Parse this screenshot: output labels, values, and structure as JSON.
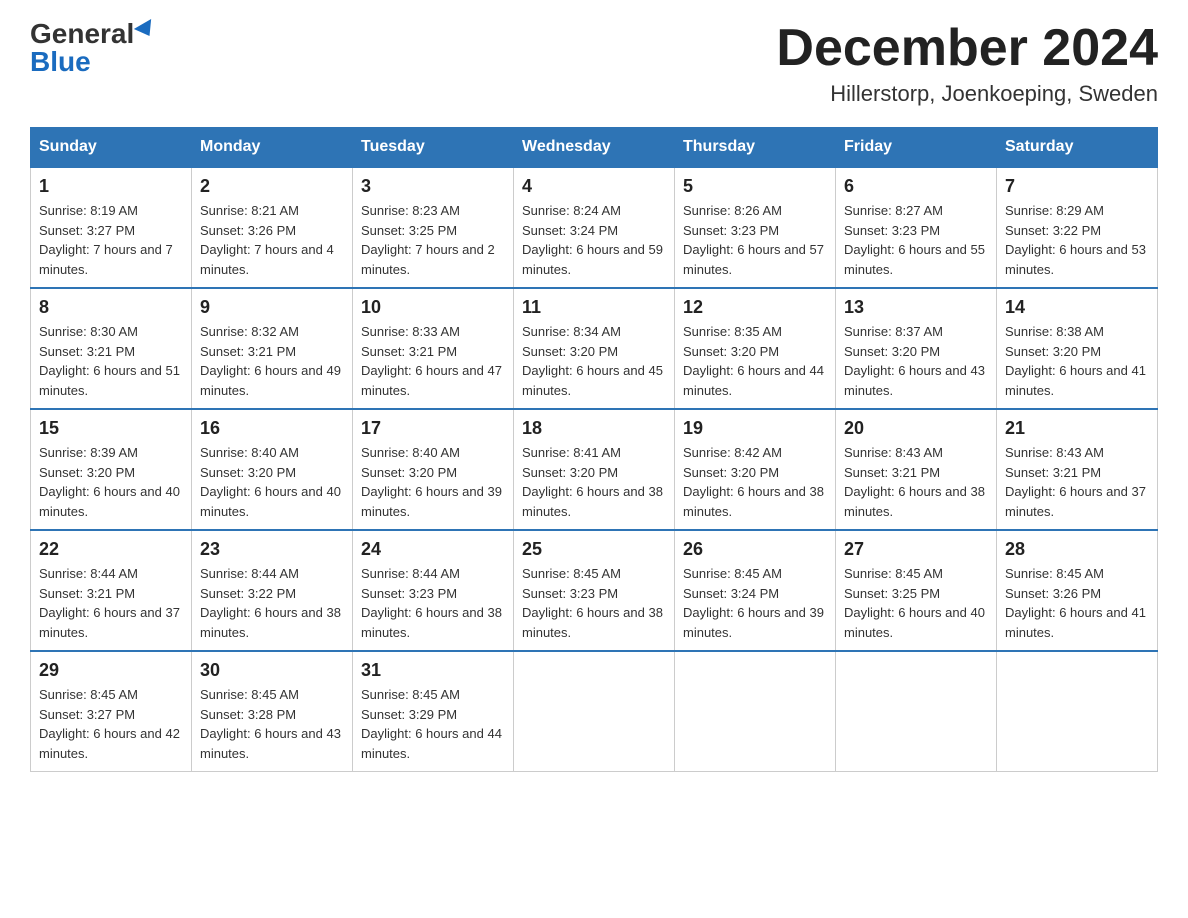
{
  "header": {
    "logo_general": "General",
    "logo_blue": "Blue",
    "month_title": "December 2024",
    "location": "Hillerstorp, Joenkoeping, Sweden"
  },
  "days_of_week": [
    "Sunday",
    "Monday",
    "Tuesday",
    "Wednesday",
    "Thursday",
    "Friday",
    "Saturday"
  ],
  "weeks": [
    [
      {
        "day": "1",
        "sunrise": "8:19 AM",
        "sunset": "3:27 PM",
        "daylight": "7 hours and 7 minutes."
      },
      {
        "day": "2",
        "sunrise": "8:21 AM",
        "sunset": "3:26 PM",
        "daylight": "7 hours and 4 minutes."
      },
      {
        "day": "3",
        "sunrise": "8:23 AM",
        "sunset": "3:25 PM",
        "daylight": "7 hours and 2 minutes."
      },
      {
        "day": "4",
        "sunrise": "8:24 AM",
        "sunset": "3:24 PM",
        "daylight": "6 hours and 59 minutes."
      },
      {
        "day": "5",
        "sunrise": "8:26 AM",
        "sunset": "3:23 PM",
        "daylight": "6 hours and 57 minutes."
      },
      {
        "day": "6",
        "sunrise": "8:27 AM",
        "sunset": "3:23 PM",
        "daylight": "6 hours and 55 minutes."
      },
      {
        "day": "7",
        "sunrise": "8:29 AM",
        "sunset": "3:22 PM",
        "daylight": "6 hours and 53 minutes."
      }
    ],
    [
      {
        "day": "8",
        "sunrise": "8:30 AM",
        "sunset": "3:21 PM",
        "daylight": "6 hours and 51 minutes."
      },
      {
        "day": "9",
        "sunrise": "8:32 AM",
        "sunset": "3:21 PM",
        "daylight": "6 hours and 49 minutes."
      },
      {
        "day": "10",
        "sunrise": "8:33 AM",
        "sunset": "3:21 PM",
        "daylight": "6 hours and 47 minutes."
      },
      {
        "day": "11",
        "sunrise": "8:34 AM",
        "sunset": "3:20 PM",
        "daylight": "6 hours and 45 minutes."
      },
      {
        "day": "12",
        "sunrise": "8:35 AM",
        "sunset": "3:20 PM",
        "daylight": "6 hours and 44 minutes."
      },
      {
        "day": "13",
        "sunrise": "8:37 AM",
        "sunset": "3:20 PM",
        "daylight": "6 hours and 43 minutes."
      },
      {
        "day": "14",
        "sunrise": "8:38 AM",
        "sunset": "3:20 PM",
        "daylight": "6 hours and 41 minutes."
      }
    ],
    [
      {
        "day": "15",
        "sunrise": "8:39 AM",
        "sunset": "3:20 PM",
        "daylight": "6 hours and 40 minutes."
      },
      {
        "day": "16",
        "sunrise": "8:40 AM",
        "sunset": "3:20 PM",
        "daylight": "6 hours and 40 minutes."
      },
      {
        "day": "17",
        "sunrise": "8:40 AM",
        "sunset": "3:20 PM",
        "daylight": "6 hours and 39 minutes."
      },
      {
        "day": "18",
        "sunrise": "8:41 AM",
        "sunset": "3:20 PM",
        "daylight": "6 hours and 38 minutes."
      },
      {
        "day": "19",
        "sunrise": "8:42 AM",
        "sunset": "3:20 PM",
        "daylight": "6 hours and 38 minutes."
      },
      {
        "day": "20",
        "sunrise": "8:43 AM",
        "sunset": "3:21 PM",
        "daylight": "6 hours and 38 minutes."
      },
      {
        "day": "21",
        "sunrise": "8:43 AM",
        "sunset": "3:21 PM",
        "daylight": "6 hours and 37 minutes."
      }
    ],
    [
      {
        "day": "22",
        "sunrise": "8:44 AM",
        "sunset": "3:21 PM",
        "daylight": "6 hours and 37 minutes."
      },
      {
        "day": "23",
        "sunrise": "8:44 AM",
        "sunset": "3:22 PM",
        "daylight": "6 hours and 38 minutes."
      },
      {
        "day": "24",
        "sunrise": "8:44 AM",
        "sunset": "3:23 PM",
        "daylight": "6 hours and 38 minutes."
      },
      {
        "day": "25",
        "sunrise": "8:45 AM",
        "sunset": "3:23 PM",
        "daylight": "6 hours and 38 minutes."
      },
      {
        "day": "26",
        "sunrise": "8:45 AM",
        "sunset": "3:24 PM",
        "daylight": "6 hours and 39 minutes."
      },
      {
        "day": "27",
        "sunrise": "8:45 AM",
        "sunset": "3:25 PM",
        "daylight": "6 hours and 40 minutes."
      },
      {
        "day": "28",
        "sunrise": "8:45 AM",
        "sunset": "3:26 PM",
        "daylight": "6 hours and 41 minutes."
      }
    ],
    [
      {
        "day": "29",
        "sunrise": "8:45 AM",
        "sunset": "3:27 PM",
        "daylight": "6 hours and 42 minutes."
      },
      {
        "day": "30",
        "sunrise": "8:45 AM",
        "sunset": "3:28 PM",
        "daylight": "6 hours and 43 minutes."
      },
      {
        "day": "31",
        "sunrise": "8:45 AM",
        "sunset": "3:29 PM",
        "daylight": "6 hours and 44 minutes."
      },
      null,
      null,
      null,
      null
    ]
  ],
  "labels": {
    "sunrise": "Sunrise:",
    "sunset": "Sunset:",
    "daylight": "Daylight:"
  }
}
